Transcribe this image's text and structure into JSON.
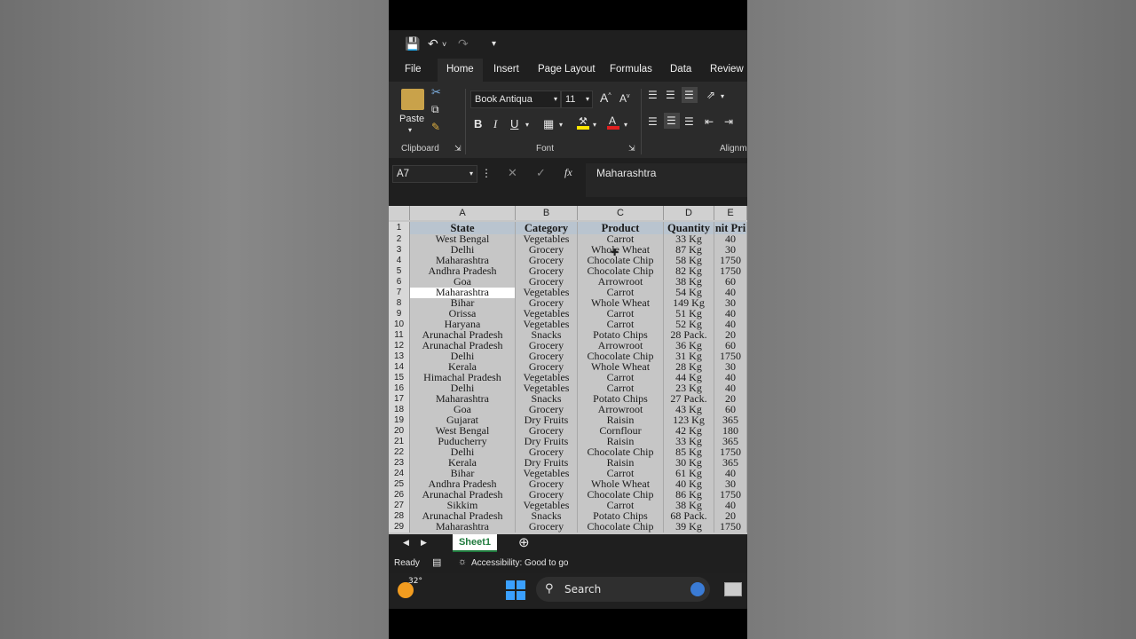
{
  "quick_access": {
    "save_icon": "save-icon",
    "undo_icon": "undo-icon",
    "redo_icon": "redo-icon",
    "customize_icon": "customize-icon"
  },
  "tabs": [
    {
      "label": "File"
    },
    {
      "label": "Home",
      "active": true
    },
    {
      "label": "Insert"
    },
    {
      "label": "Page Layout"
    },
    {
      "label": "Formulas"
    },
    {
      "label": "Data"
    },
    {
      "label": "Review"
    }
  ],
  "ribbon": {
    "paste_label": "Paste",
    "clipboard_label": "Clipboard",
    "font_name": "Book Antiqua",
    "font_size": "11",
    "font_group_label": "Font",
    "alignment_label": "Alignm",
    "bold": "B",
    "italic": "I",
    "underline": "U"
  },
  "formula_bar": {
    "name_box": "A7",
    "fx": "fx",
    "value": "Maharashtra"
  },
  "columns": [
    "A",
    "B",
    "C",
    "D",
    "E"
  ],
  "header_row": {
    "num": "1",
    "cells": [
      "State",
      "Category",
      "Product",
      "Quantity",
      "nit Pri"
    ]
  },
  "rows": [
    {
      "num": "2",
      "cells": [
        "West Bengal",
        "Vegetables",
        "Carrot",
        "33 Kg",
        "40"
      ]
    },
    {
      "num": "3",
      "cells": [
        "Delhi",
        "Grocery",
        "Whole Wheat",
        "87 Kg",
        "30"
      ]
    },
    {
      "num": "4",
      "cells": [
        "Maharashtra",
        "Grocery",
        "Chocolate Chip",
        "58 Kg",
        "1750"
      ]
    },
    {
      "num": "5",
      "cells": [
        "Andhra Pradesh",
        "Grocery",
        "Chocolate Chip",
        "82 Kg",
        "1750"
      ]
    },
    {
      "num": "6",
      "cells": [
        "Goa",
        "Grocery",
        "Arrowroot",
        "38 Kg",
        "60"
      ]
    },
    {
      "num": "7",
      "cells": [
        "Maharashtra",
        "Vegetables",
        "Carrot",
        "54 Kg",
        "40"
      ]
    },
    {
      "num": "8",
      "cells": [
        "Bihar",
        "Grocery",
        "Whole Wheat",
        "149 Kg",
        "30"
      ]
    },
    {
      "num": "9",
      "cells": [
        "Orissa",
        "Vegetables",
        "Carrot",
        "51 Kg",
        "40"
      ]
    },
    {
      "num": "10",
      "cells": [
        "Haryana",
        "Vegetables",
        "Carrot",
        "52 Kg",
        "40"
      ]
    },
    {
      "num": "11",
      "cells": [
        "Arunachal Pradesh",
        "Snacks",
        "Potato Chips",
        "28 Pack.",
        "20"
      ]
    },
    {
      "num": "12",
      "cells": [
        "Arunachal Pradesh",
        "Grocery",
        "Arrowroot",
        "36 Kg",
        "60"
      ]
    },
    {
      "num": "13",
      "cells": [
        "Delhi",
        "Grocery",
        "Chocolate Chip",
        "31 Kg",
        "1750"
      ]
    },
    {
      "num": "14",
      "cells": [
        "Kerala",
        "Grocery",
        "Whole Wheat",
        "28 Kg",
        "30"
      ]
    },
    {
      "num": "15",
      "cells": [
        "Himachal Pradesh",
        "Vegetables",
        "Carrot",
        "44 Kg",
        "40"
      ]
    },
    {
      "num": "16",
      "cells": [
        "Delhi",
        "Vegetables",
        "Carrot",
        "23 Kg",
        "40"
      ]
    },
    {
      "num": "17",
      "cells": [
        "Maharashtra",
        "Snacks",
        "Potato Chips",
        "27 Pack.",
        "20"
      ]
    },
    {
      "num": "18",
      "cells": [
        "Goa",
        "Grocery",
        "Arrowroot",
        "43 Kg",
        "60"
      ]
    },
    {
      "num": "19",
      "cells": [
        "Gujarat",
        "Dry Fruits",
        "Raisin",
        "123 Kg",
        "365"
      ]
    },
    {
      "num": "20",
      "cells": [
        "West Bengal",
        "Grocery",
        "Cornflour",
        "42 Kg",
        "180"
      ]
    },
    {
      "num": "21",
      "cells": [
        "Puducherry",
        "Dry Fruits",
        "Raisin",
        "33 Kg",
        "365"
      ]
    },
    {
      "num": "22",
      "cells": [
        "Delhi",
        "Grocery",
        "Chocolate Chip",
        "85 Kg",
        "1750"
      ]
    },
    {
      "num": "23",
      "cells": [
        "Kerala",
        "Dry Fruits",
        "Raisin",
        "30 Kg",
        "365"
      ]
    },
    {
      "num": "24",
      "cells": [
        "Bihar",
        "Vegetables",
        "Carrot",
        "61 Kg",
        "40"
      ]
    },
    {
      "num": "25",
      "cells": [
        "Andhra Pradesh",
        "Grocery",
        "Whole Wheat",
        "40 Kg",
        "30"
      ]
    },
    {
      "num": "26",
      "cells": [
        "Arunachal Pradesh",
        "Grocery",
        "Chocolate Chip",
        "86 Kg",
        "1750"
      ]
    },
    {
      "num": "27",
      "cells": [
        "Sikkim",
        "Vegetables",
        "Carrot",
        "38 Kg",
        "40"
      ]
    },
    {
      "num": "28",
      "cells": [
        "Arunachal Pradesh",
        "Snacks",
        "Potato Chips",
        "68 Pack.",
        "20"
      ]
    },
    {
      "num": "29",
      "cells": [
        "Maharashtra",
        "Grocery",
        "Chocolate Chip",
        "39 Kg",
        "1750"
      ]
    }
  ],
  "sheet_tab": "Sheet1",
  "status": {
    "ready": "Ready",
    "accessibility": "Accessibility: Good to go"
  },
  "taskbar": {
    "temperature": "32°",
    "search_label": "Search"
  },
  "colors": {
    "accent": "#4ea26b",
    "header_fill": "#b9c4cf",
    "cell_fill": "#c6c6c6"
  }
}
